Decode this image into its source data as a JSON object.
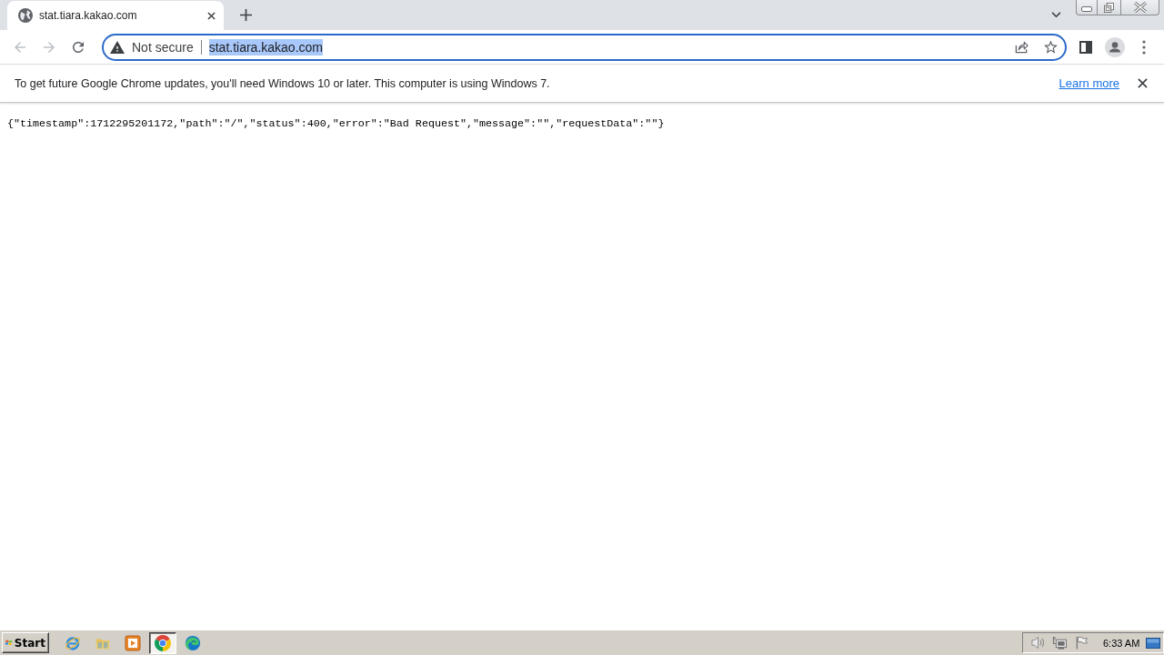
{
  "tabs": [
    {
      "title": "stat.tiara.kakao.com",
      "selected": true
    }
  ],
  "toolbar": {
    "back": {
      "disabled": true
    },
    "forward": {
      "disabled": true
    },
    "address_bar": {
      "security": "Not secure",
      "url": "stat.tiara.kakao.com",
      "url_selected": true
    }
  },
  "infobar": {
    "message": "To get future Google Chrome updates, you'll need Windows 10 or later. This computer is using Windows 7.",
    "link": "Learn more"
  },
  "page": {
    "text": "{\"timestamp\":1712295201172,\"path\":\"/\",\"status\":400,\"error\":\"Bad Request\",\"message\":\"\",\"requestData\":\"\"}"
  },
  "taskbar": {
    "start": "Start",
    "apps": [
      {
        "selected": false
      },
      {
        "selected": false
      },
      {
        "selected": false
      },
      {
        "selected": true
      },
      {
        "selected": false
      }
    ],
    "clock": "6:33 AM"
  }
}
